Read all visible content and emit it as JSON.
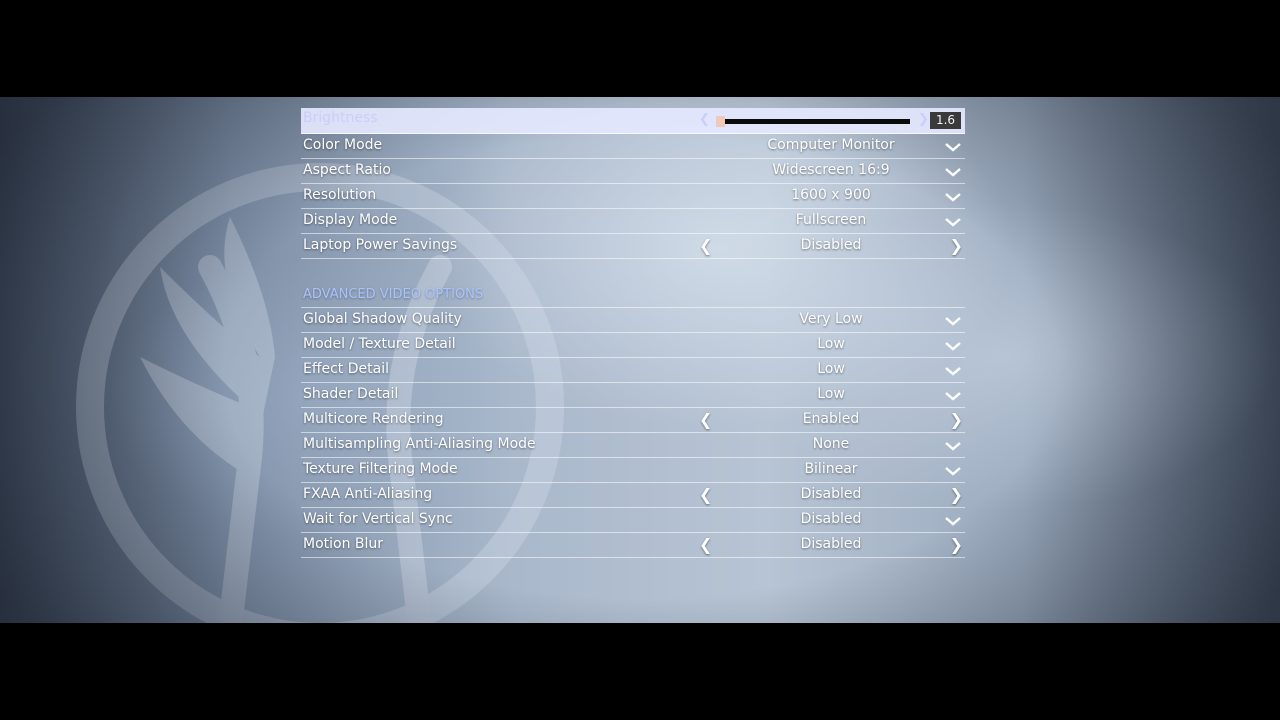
{
  "colors": {
    "accent": "#a9c3ff",
    "selected_bg": "#e4e8ff",
    "slider_thumb": "#f0c9b8"
  },
  "basic": [
    {
      "id": "brightness",
      "label": "Brightness",
      "control": "slider",
      "value": "1.6",
      "selected": true
    },
    {
      "id": "color-mode",
      "label": "Color Mode",
      "control": "dropdown",
      "value": "Computer Monitor"
    },
    {
      "id": "aspect-ratio",
      "label": "Aspect Ratio",
      "control": "dropdown",
      "value": "Widescreen 16:9"
    },
    {
      "id": "resolution",
      "label": "Resolution",
      "control": "dropdown",
      "value": "1600 x 900"
    },
    {
      "id": "display-mode",
      "label": "Display Mode",
      "control": "dropdown",
      "value": "Fullscreen"
    },
    {
      "id": "laptop-power-savings",
      "label": "Laptop Power Savings",
      "control": "toggle",
      "value": "Disabled"
    }
  ],
  "advanced_header": "ADVANCED VIDEO OPTIONS",
  "advanced": [
    {
      "id": "global-shadow-quality",
      "label": "Global Shadow Quality",
      "control": "dropdown",
      "value": "Very Low"
    },
    {
      "id": "model-texture-detail",
      "label": "Model / Texture Detail",
      "control": "dropdown",
      "value": "Low"
    },
    {
      "id": "effect-detail",
      "label": "Effect Detail",
      "control": "dropdown",
      "value": "Low"
    },
    {
      "id": "shader-detail",
      "label": "Shader Detail",
      "control": "dropdown",
      "value": "Low"
    },
    {
      "id": "multicore-rendering",
      "label": "Multicore Rendering",
      "control": "toggle",
      "value": "Enabled"
    },
    {
      "id": "msaa-mode",
      "label": "Multisampling Anti-Aliasing Mode",
      "control": "dropdown",
      "value": "None"
    },
    {
      "id": "texture-filtering-mode",
      "label": "Texture Filtering Mode",
      "control": "dropdown",
      "value": "Bilinear"
    },
    {
      "id": "fxaa-anti-aliasing",
      "label": "FXAA Anti-Aliasing",
      "control": "toggle",
      "value": "Disabled"
    },
    {
      "id": "wait-for-vertical-sync",
      "label": "Wait for Vertical Sync",
      "control": "dropdown",
      "value": "Disabled"
    },
    {
      "id": "motion-blur",
      "label": "Motion Blur",
      "control": "toggle",
      "value": "Disabled"
    }
  ],
  "icons": {
    "dropdown": "chevron-down-icon",
    "left": "chevron-left-icon",
    "right": "chevron-right-icon"
  }
}
